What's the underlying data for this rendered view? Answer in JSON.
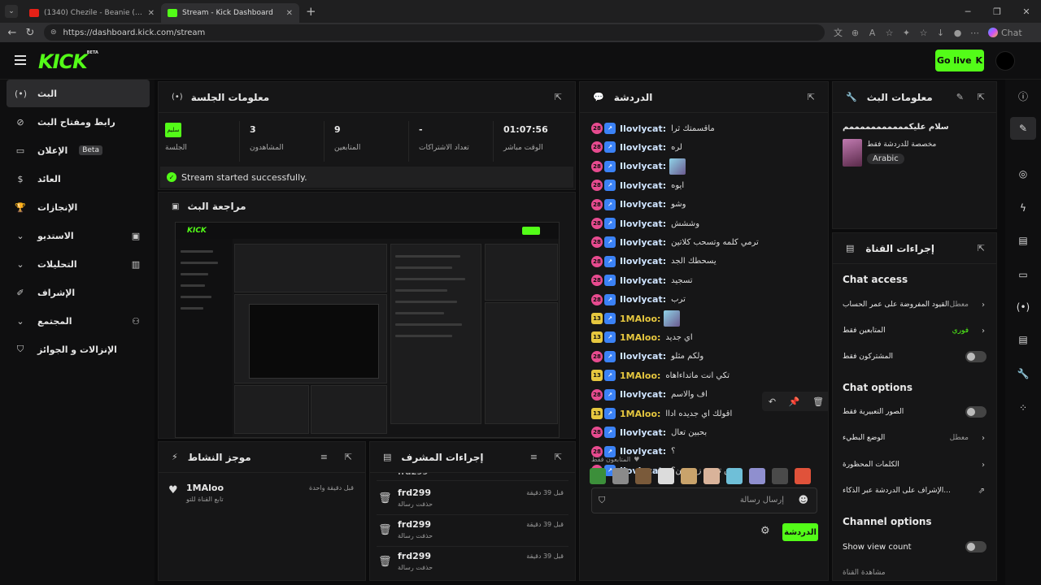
{
  "browser": {
    "tabs": [
      {
        "title": "(1340) Chezile - Beanie (Lyrics) - Yo",
        "icon": "youtube-icon"
      },
      {
        "title": "Stream - Kick Dashboard",
        "icon": "kick-icon"
      }
    ],
    "url": "https://dashboard.kick.com/stream",
    "copilot_label": "Chat"
  },
  "header": {
    "logo": "KICK",
    "logo_tag": "BETA",
    "go_live": "Go live"
  },
  "sidebar": {
    "items": [
      {
        "label": "البث",
        "icon": "live-icon"
      },
      {
        "label": "رابط ومفتاح البث",
        "icon": "link-icon"
      },
      {
        "label": "الإعلان",
        "icon": "ad-icon",
        "badge": "Beta"
      },
      {
        "label": "العائد",
        "icon": "revenue-icon"
      },
      {
        "label": "الإنجازات",
        "icon": "trophy-icon"
      },
      {
        "label": "الاستديو",
        "icon": "studio-icon"
      },
      {
        "label": "التحليلات",
        "icon": "analytics-icon"
      },
      {
        "label": "الإشراف",
        "icon": "moderation-icon"
      },
      {
        "label": "المجتمع",
        "icon": "community-icon"
      },
      {
        "label": "الإنزالات و الجوائز",
        "icon": "drops-icon"
      }
    ]
  },
  "session": {
    "title": "معلومات الجلسة",
    "status_value": "سليم",
    "status_label": "الجلسة",
    "viewers_value": "3",
    "viewers_label": "المشاهدون",
    "followers_value": "9",
    "followers_label": "المتابعين",
    "subs_value": "-",
    "subs_label": "تعداد الاشتراكات",
    "uptime_value": "01:07:56",
    "uptime_label": "الوقت مباشر",
    "success": "Stream started successfully."
  },
  "preview": {
    "title": "مراجعة البث"
  },
  "activity": {
    "title": "موجز النشاط",
    "items": [
      {
        "user": "1MAloo",
        "action": "تابع القناة للتو",
        "time": "قبل دقيقة واحدة"
      }
    ]
  },
  "modactions": {
    "title": "إجراءات المشرف",
    "cut_user": "frd299",
    "items": [
      {
        "user": "frd299",
        "action": "حذفت رسالة",
        "time": "قبل 39 دقيقة"
      },
      {
        "user": "frd299",
        "action": "حذفت رسالة",
        "time": "قبل 39 دقيقة"
      },
      {
        "user": "frd299",
        "action": "حذفت رسالة",
        "time": "قبل 39 دقيقة"
      }
    ]
  },
  "chat": {
    "title": "الدردشة",
    "messages": [
      {
        "badge": "28",
        "user": "Ilovlycat:",
        "text": "ماقسمتك ثرا",
        "color": "#cfe4ff"
      },
      {
        "badge": "28",
        "user": "Ilovlycat:",
        "text": "لره",
        "color": "#cfe4ff"
      },
      {
        "badge": "28",
        "user": "Ilovlycat:",
        "text": "",
        "color": "#cfe4ff",
        "emote": true
      },
      {
        "badge": "28",
        "user": "Ilovlycat:",
        "text": "ايوه",
        "color": "#cfe4ff"
      },
      {
        "badge": "28",
        "user": "Ilovlycat:",
        "text": "وشو",
        "color": "#cfe4ff"
      },
      {
        "badge": "28",
        "user": "Ilovlycat:",
        "text": "وششش",
        "color": "#cfe4ff"
      },
      {
        "badge": "28",
        "user": "Ilovlycat:",
        "text": "ترمي كلمه وتسحب كلاتين",
        "color": "#cfe4ff"
      },
      {
        "badge": "28",
        "user": "Ilovlycat:",
        "text": "يسحطك الجد",
        "color": "#cfe4ff"
      },
      {
        "badge": "28",
        "user": "Ilovlycat:",
        "text": "تسجيد",
        "color": "#cfe4ff"
      },
      {
        "badge": "28",
        "user": "Ilovlycat:",
        "text": "ترب",
        "color": "#cfe4ff"
      },
      {
        "badge": "13",
        "user": "1MAloo:",
        "text": "",
        "color": "#e6c73f",
        "emote": true
      },
      {
        "badge": "13",
        "user": "1MAloo:",
        "text": "اي جديد",
        "color": "#e6c73f"
      },
      {
        "badge": "28",
        "user": "Ilovlycat:",
        "text": "ولكم مثلو",
        "color": "#cfe4ff"
      },
      {
        "badge": "13",
        "user": "1MAloo:",
        "text": "تكي انت ماتداءاهاه",
        "color": "#e6c73f"
      },
      {
        "badge": "28",
        "user": "Ilovlycat:",
        "text": "اف والاسم",
        "color": "#cfe4ff"
      },
      {
        "badge": "13",
        "user": "1MAloo:",
        "text": "اقولك اي جديده اداا",
        "color": "#e6c73f"
      },
      {
        "badge": "28",
        "user": "Ilovlycat:",
        "text": "بحبين تعال",
        "color": "#cfe4ff"
      },
      {
        "badge": "28",
        "user": "Ilovlycat:",
        "text": "؟",
        "color": "#cfe4ff"
      },
      {
        "badge": "28",
        "user": "Ilovlycat:",
        "text": "وش تسب زي مين؟",
        "color": "#cfe4ff"
      }
    ],
    "followers_only": "المتابعون فقط",
    "input_placeholder": "إرسال رسالة",
    "send": "الدردشة"
  },
  "streaminfo": {
    "title": "معلومات البث",
    "stream_title": "سلام عليكمممممممممممم",
    "category": "مخصصة للدردشة فقط",
    "language": "Arabic"
  },
  "channel": {
    "title": "إجراءات القناة",
    "chat_access": "Chat access",
    "age_restrict": "القيود المفروضة على عمر الحساب",
    "age_value": "معطل",
    "followers_only": "المتابعين فقط",
    "followers_value": "فوري",
    "subs_only": "المشتركون فقط",
    "chat_options": "Chat options",
    "emote_only": "الصور التعبيرية فقط",
    "slow_mode": "الوضع البطيء",
    "slow_value": "معطل",
    "banned_words": "الكلمات المحظورة",
    "ai_mod": "...الإشراف على الدردشة عبر الذكاء",
    "channel_options": "Channel options",
    "show_view_count": "Show view count",
    "share": "مشاهدة القناة"
  },
  "colors": {
    "accent": "#53fc18",
    "bg": "#0b0b0c",
    "panel": "#161617"
  }
}
